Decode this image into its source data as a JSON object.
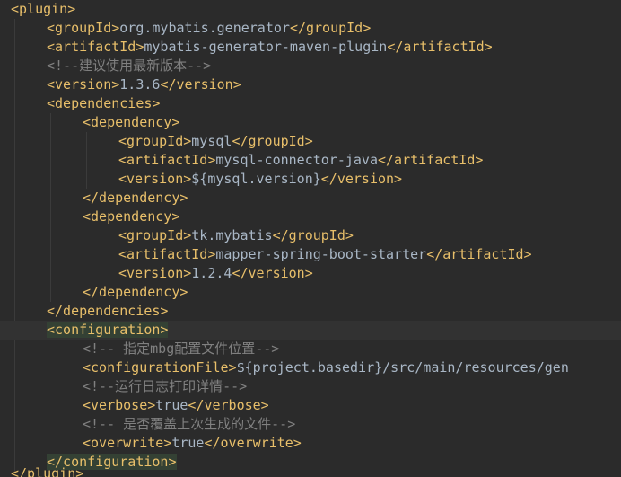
{
  "lines": [
    {
      "parts": [
        {
          "t": "<plugin>",
          "c": "tag"
        }
      ]
    },
    {
      "parts": [
        {
          "t": "<groupId>",
          "c": "tag"
        },
        {
          "t": "org.mybatis.generator",
          "c": "val"
        },
        {
          "t": "</groupId>",
          "c": "tag"
        }
      ]
    },
    {
      "parts": [
        {
          "t": "<artifactId>",
          "c": "tag"
        },
        {
          "t": "mybatis-generator-maven-plugin",
          "c": "val"
        },
        {
          "t": "</artifactId>",
          "c": "tag"
        }
      ]
    },
    {
      "parts": [
        {
          "t": "<!--建议使用最新版本-->",
          "c": "cmt"
        }
      ]
    },
    {
      "parts": [
        {
          "t": "<version>",
          "c": "tag"
        },
        {
          "t": "1.3.6",
          "c": "val"
        },
        {
          "t": "</version>",
          "c": "tag"
        }
      ]
    },
    {
      "parts": [
        {
          "t": "<dependencies>",
          "c": "tag"
        }
      ]
    },
    {
      "parts": [
        {
          "t": "<dependency>",
          "c": "tag"
        }
      ]
    },
    {
      "parts": [
        {
          "t": "<groupId>",
          "c": "tag"
        },
        {
          "t": "mysql",
          "c": "val"
        },
        {
          "t": "</groupId>",
          "c": "tag"
        }
      ]
    },
    {
      "parts": [
        {
          "t": "<artifactId>",
          "c": "tag"
        },
        {
          "t": "mysql-connector-java",
          "c": "val"
        },
        {
          "t": "</artifactId>",
          "c": "tag"
        }
      ]
    },
    {
      "parts": [
        {
          "t": "<version>",
          "c": "tag"
        },
        {
          "t": "${mysql.version}",
          "c": "val"
        },
        {
          "t": "</version>",
          "c": "tag"
        }
      ]
    },
    {
      "parts": [
        {
          "t": "</dependency>",
          "c": "tag"
        }
      ]
    },
    {
      "parts": [
        {
          "t": "<dependency>",
          "c": "tag"
        }
      ]
    },
    {
      "parts": [
        {
          "t": "<groupId>",
          "c": "tag"
        },
        {
          "t": "tk.mybatis",
          "c": "val"
        },
        {
          "t": "</groupId>",
          "c": "tag"
        }
      ]
    },
    {
      "parts": [
        {
          "t": "<artifactId>",
          "c": "tag"
        },
        {
          "t": "mapper-spring-boot-starter",
          "c": "val"
        },
        {
          "t": "</artifactId>",
          "c": "tag"
        }
      ]
    },
    {
      "parts": [
        {
          "t": "<version>",
          "c": "tag"
        },
        {
          "t": "1.2.4",
          "c": "val"
        },
        {
          "t": "</version>",
          "c": "tag"
        }
      ]
    },
    {
      "parts": [
        {
          "t": "</dependency>",
          "c": "tag"
        }
      ]
    },
    {
      "parts": [
        {
          "t": "</dependencies>",
          "c": "tag"
        }
      ]
    },
    {
      "parts": [
        {
          "t": "<configuration>",
          "c": "tag",
          "hl": true
        }
      ]
    },
    {
      "parts": [
        {
          "t": "<!-- 指定mbg配置文件位置-->",
          "c": "cmt"
        }
      ]
    },
    {
      "parts": [
        {
          "t": "<configurationFile>",
          "c": "tag"
        },
        {
          "t": "${project.basedir}/src/main/resources/gen",
          "c": "val"
        }
      ]
    },
    {
      "parts": [
        {
          "t": "<!--运行日志打印详情-->",
          "c": "cmt"
        }
      ]
    },
    {
      "parts": [
        {
          "t": "<verbose>",
          "c": "tag"
        },
        {
          "t": "true",
          "c": "val"
        },
        {
          "t": "</verbose>",
          "c": "tag"
        }
      ]
    },
    {
      "parts": [
        {
          "t": "<!-- 是否覆盖上次生成的文件-->",
          "c": "cmt"
        }
      ]
    },
    {
      "parts": [
        {
          "t": "<overwrite>",
          "c": "tag"
        },
        {
          "t": "true",
          "c": "val"
        },
        {
          "t": "</overwrite>",
          "c": "tag"
        }
      ]
    },
    {
      "parts": [
        {
          "t": "</configuration>",
          "c": "tag",
          "hl": true
        }
      ]
    },
    {
      "parts": [
        {
          "t": "</plugin>",
          "c": "tag"
        }
      ]
    }
  ],
  "colors": {
    "background": "#2b2b2b",
    "tag": "#e8bf6a",
    "value": "#a9b7c6",
    "comment": "#808080",
    "bracket_match": "#344134",
    "current_line": "#323232"
  }
}
